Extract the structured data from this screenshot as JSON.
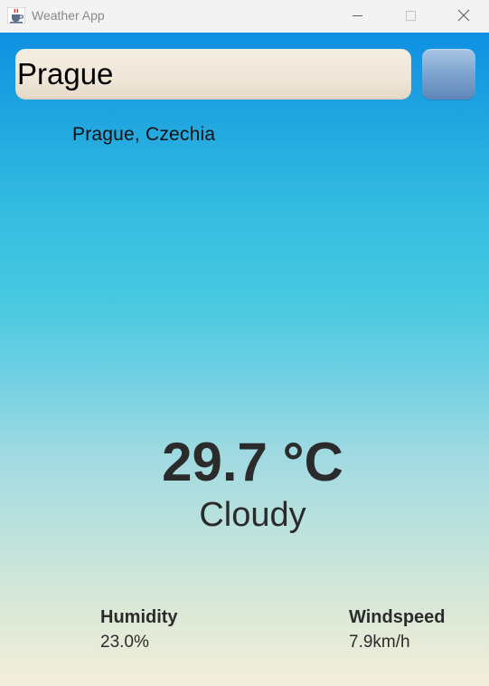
{
  "window": {
    "title": "Weather App",
    "icon": "java-cup-icon",
    "controls": [
      "minimize-icon",
      "maximize-icon",
      "close-icon"
    ]
  },
  "search": {
    "value": "Prague",
    "button_icon": "none"
  },
  "location": "Prague, Czechia",
  "weather": {
    "temperature": "29.7 °C",
    "condition": "Cloudy"
  },
  "stats": {
    "humidity_label": "Humidity",
    "humidity_value": "23.0%",
    "windspeed_label": "Windspeed",
    "windspeed_value": "7.9km/h"
  },
  "colors": {
    "gradient_top": "#0f90e2",
    "gradient_mid": "#45c8e0",
    "gradient_bottom": "#f4eedb",
    "search_field": "#efe6d8",
    "search_button": "#7ea3cf",
    "text": "#2b2b2b"
  }
}
